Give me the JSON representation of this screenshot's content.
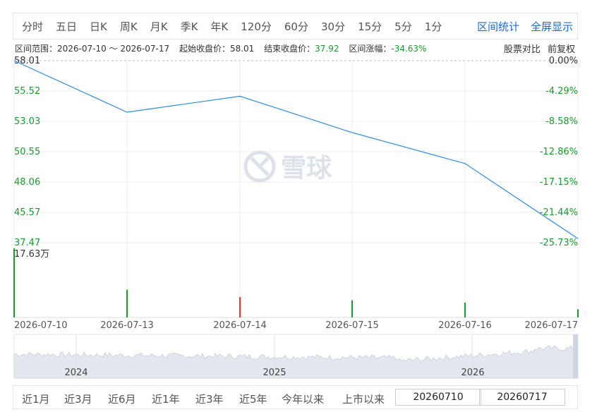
{
  "period_tabs": [
    "分时",
    "五日",
    "日K",
    "周K",
    "月K",
    "季K",
    "年K",
    "120分",
    "60分",
    "30分",
    "15分",
    "5分",
    "1分"
  ],
  "right_links": [
    "区间统计",
    "全屏显示"
  ],
  "info": {
    "range_label": "区间范围：2026-07-10 ～ 2026-07-17",
    "start_price_label": "起始收盘价：",
    "start_price": "58.01",
    "end_price_label": "结束收盘价：",
    "end_price": "37.92",
    "change_label": "区间涨幅：",
    "change": "-34.63%",
    "compare": "股票对比",
    "adjust": "前复权"
  },
  "chart_data": {
    "type": "line",
    "x": [
      "2026-07-10",
      "2026-07-13",
      "2026-07-14",
      "2026-07-15",
      "2026-07-16",
      "2026-07-17"
    ],
    "series": [
      {
        "values": [
          58.01,
          52.2,
          54.0,
          49.9,
          46.4,
          37.92
        ]
      }
    ],
    "y_ticks_left": [
      "58.01",
      "55.52",
      "53.03",
      "50.55",
      "48.06",
      "45.57",
      "37.47"
    ],
    "y_ticks_right": [
      "0.00%",
      "-4.29%",
      "-8.58%",
      "-12.86%",
      "-17.15%",
      "-21.44%",
      "-25.73%"
    ],
    "volume_max_label": "17.63万",
    "volume": [
      17.63,
      7.1,
      5.2,
      4.4,
      3.8,
      2.1
    ],
    "volume_colors": [
      "#1a9b30",
      "#1a9b30",
      "#e03a1e",
      "#1a9b30",
      "#1a9b30",
      "#1a9b30"
    ],
    "overview_years": [
      "2024",
      "2025",
      "2026"
    ],
    "watermark": "雪球",
    "colors": {
      "line": "#2f8be6",
      "up": "#e03a1e",
      "down": "#1a9b30"
    }
  },
  "range_buttons": [
    "近1月",
    "近3月",
    "近6月",
    "近1年",
    "近3年",
    "近5年",
    "今年以来",
    "上市以来"
  ],
  "date_from": "20260710",
  "date_to": "20260717"
}
